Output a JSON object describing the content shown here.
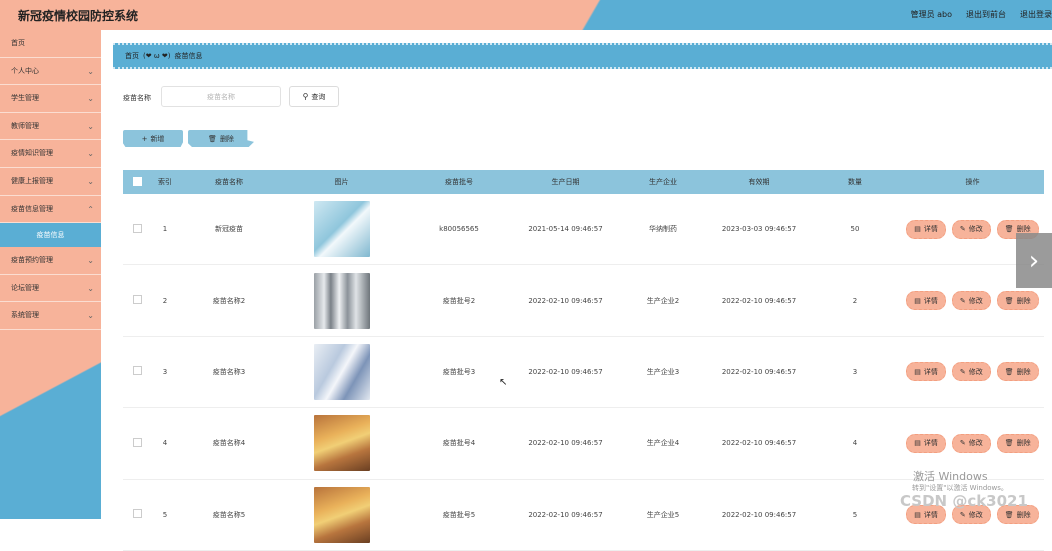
{
  "header": {
    "title": "新冠疫情校园防控系统",
    "admin": "管理员 abo",
    "back_front": "退出到前台",
    "logout": "退出登录"
  },
  "sidebar": {
    "items": [
      {
        "label": "首页",
        "chevron": false
      },
      {
        "label": "个人中心",
        "chevron": true
      },
      {
        "label": "学生管理",
        "chevron": true
      },
      {
        "label": "教师管理",
        "chevron": true
      },
      {
        "label": "疫情知识管理",
        "chevron": true
      },
      {
        "label": "健康上报管理",
        "chevron": true
      },
      {
        "label": "疫苗信息管理",
        "chevron": true
      },
      {
        "label": "疫苗信息",
        "chevron": false,
        "active": true
      },
      {
        "label": "疫苗预约管理",
        "chevron": true
      },
      {
        "label": "论坛管理",
        "chevron": true
      },
      {
        "label": "系统管理",
        "chevron": true
      }
    ]
  },
  "breadcrumb": {
    "home": "首页",
    "separator": "(❤ ω ❤)",
    "current": "疫苗信息"
  },
  "search": {
    "label": "疫苗名称",
    "placeholder": "疫苗名称",
    "button": "查询"
  },
  "toolbar": {
    "add": "新增",
    "delete": "删除"
  },
  "table": {
    "columns": [
      "索引",
      "疫苗名称",
      "图片",
      "疫苗批号",
      "生产日期",
      "生产企业",
      "有效期",
      "数量",
      "操作"
    ],
    "rows": [
      {
        "index": "1",
        "name": "新冠疫苗",
        "batch": "k80056565",
        "produced": "2021-05-14 09:46:57",
        "enterprise": "华纳制药",
        "expiry": "2023-03-03 09:46:57",
        "qty": "50"
      },
      {
        "index": "2",
        "name": "疫苗名称2",
        "batch": "疫苗批号2",
        "produced": "2022-02-10 09:46:57",
        "enterprise": "生产企业2",
        "expiry": "2022-02-10 09:46:57",
        "qty": "2"
      },
      {
        "index": "3",
        "name": "疫苗名称3",
        "batch": "疫苗批号3",
        "produced": "2022-02-10 09:46:57",
        "enterprise": "生产企业3",
        "expiry": "2022-02-10 09:46:57",
        "qty": "3"
      },
      {
        "index": "4",
        "name": "疫苗名称4",
        "batch": "疫苗批号4",
        "produced": "2022-02-10 09:46:57",
        "enterprise": "生产企业4",
        "expiry": "2022-02-10 09:46:57",
        "qty": "4"
      },
      {
        "index": "5",
        "name": "疫苗名称5",
        "batch": "疫苗批号5",
        "produced": "2022-02-10 09:46:57",
        "enterprise": "生产企业5",
        "expiry": "2022-02-10 09:46:57",
        "qty": "5"
      }
    ],
    "ops": {
      "detail": "详情",
      "edit": "修改",
      "delete": "删除"
    }
  },
  "watermark": {
    "activate_title": "激活 Windows",
    "activate_sub": "转到\"设置\"以激活 Windows。",
    "csdn": "CSDN @ck3021"
  },
  "colors": {
    "salmon": "#f7b39a",
    "blue": "#5aaed4",
    "table_header": "#8cc4dc"
  }
}
